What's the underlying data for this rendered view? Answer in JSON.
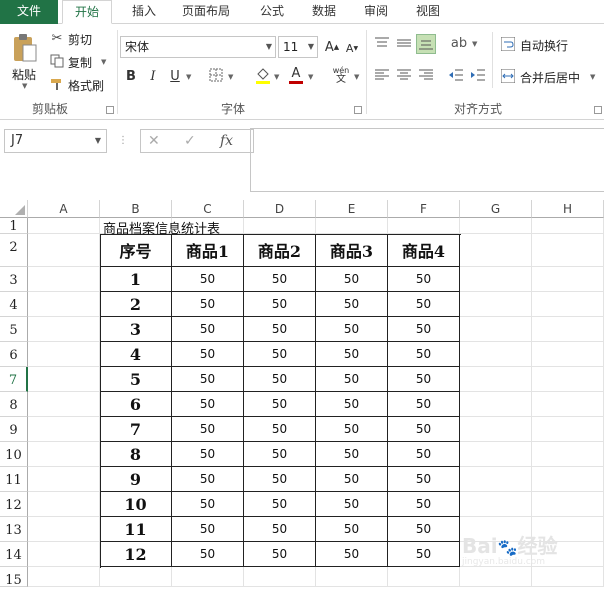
{
  "tabs": [
    "文件",
    "开始",
    "插入",
    "页面布局",
    "公式",
    "数据",
    "审阅",
    "视图"
  ],
  "ribbon": {
    "clipboard": {
      "label": "剪贴板",
      "paste": "粘贴",
      "cut": "剪切",
      "copy": "复制",
      "format_painter": "格式刷"
    },
    "font": {
      "label": "字体",
      "name": "宋体",
      "size": "11",
      "bold": "B",
      "italic": "I",
      "underline": "U",
      "wen": "wén"
    },
    "align": {
      "label": "对齐方式",
      "wrap": "自动换行",
      "merge": "合并后居中"
    }
  },
  "formula_bar": {
    "cell_ref": "J7",
    "cancel": "✕",
    "enter": "✓",
    "fx": "fx",
    "value": ""
  },
  "columns": [
    "A",
    "B",
    "C",
    "D",
    "E",
    "F",
    "G",
    "H"
  ],
  "rows": [
    "1",
    "2",
    "3",
    "4",
    "5",
    "6",
    "7",
    "8",
    "9",
    "10",
    "11",
    "12",
    "13",
    "14",
    "15"
  ],
  "selected_row": "7",
  "sheet": {
    "title": "商品档案信息统计表",
    "headers": [
      "序号",
      "商品1",
      "商品2",
      "商品3",
      "商品4"
    ],
    "data": [
      [
        "1",
        "50",
        "50",
        "50",
        "50"
      ],
      [
        "2",
        "50",
        "50",
        "50",
        "50"
      ],
      [
        "3",
        "50",
        "50",
        "50",
        "50"
      ],
      [
        "4",
        "50",
        "50",
        "50",
        "50"
      ],
      [
        "5",
        "50",
        "50",
        "50",
        "50"
      ],
      [
        "6",
        "50",
        "50",
        "50",
        "50"
      ],
      [
        "7",
        "50",
        "50",
        "50",
        "50"
      ],
      [
        "8",
        "50",
        "50",
        "50",
        "50"
      ],
      [
        "9",
        "50",
        "50",
        "50",
        "50"
      ],
      [
        "10",
        "50",
        "50",
        "50",
        "50"
      ],
      [
        "11",
        "50",
        "50",
        "50",
        "50"
      ],
      [
        "12",
        "50",
        "50",
        "50",
        "50"
      ]
    ]
  },
  "colors": {
    "accent": "#217346"
  }
}
